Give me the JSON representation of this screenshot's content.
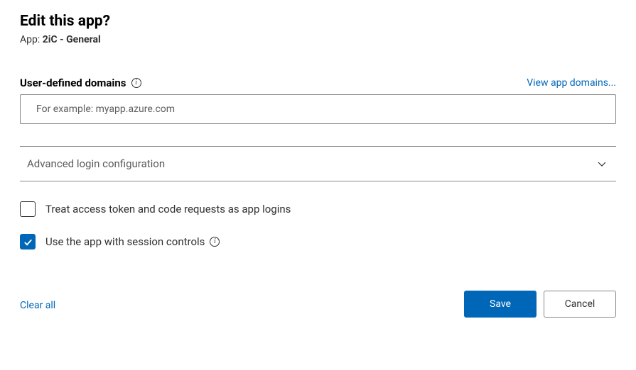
{
  "dialog": {
    "title": "Edit this app?",
    "subtitle_prefix": "App: ",
    "app_name": "2iC - General"
  },
  "domains": {
    "header": "User-defined domains",
    "view_link": "View app domains...",
    "input_value": "",
    "input_placeholder": "For example: myapp.azure.com"
  },
  "expander": {
    "label": "Advanced login configuration",
    "expanded": false
  },
  "options": {
    "treat_token": {
      "label": "Treat access token and code requests as app logins",
      "checked": false
    },
    "session_controls": {
      "label": "Use the app with session controls",
      "checked": true
    }
  },
  "footer": {
    "clear_all": "Clear all",
    "save": "Save",
    "cancel": "Cancel"
  }
}
